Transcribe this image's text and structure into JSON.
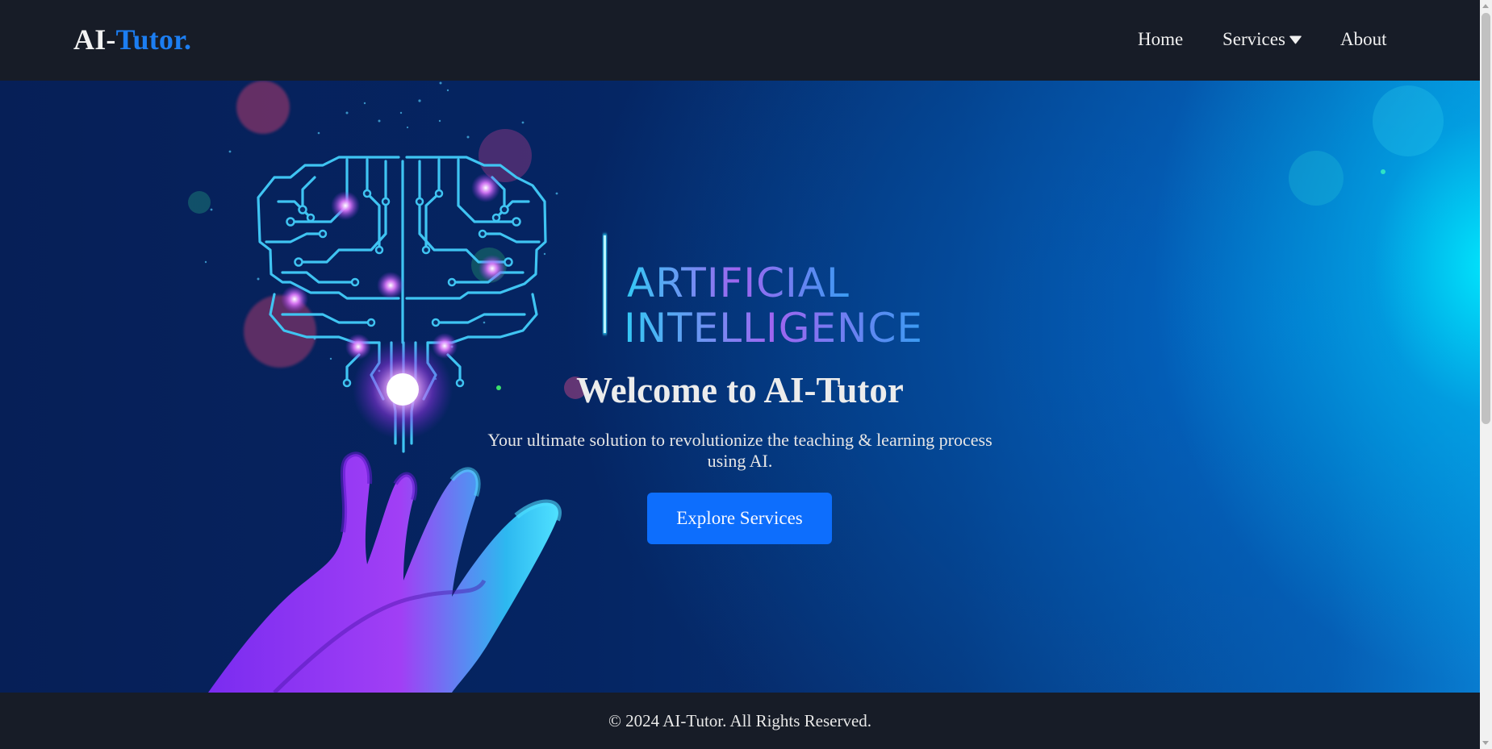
{
  "brand": {
    "prefix": "AI-",
    "accent": "Tutor."
  },
  "nav": {
    "home": "Home",
    "services": "Services",
    "about": "About",
    "services_icon": "caret-down-icon"
  },
  "hero": {
    "artwork_text_line1": "ARTIFICIAL",
    "artwork_text_line2": "INTELLIGENCE",
    "title": "Welcome to AI-Tutor",
    "subtitle": "Your ultimate solution to revolutionize the teaching & learning process using AI.",
    "cta_label": "Explore Services"
  },
  "footer": {
    "text": "© 2024 AI-Tutor. All Rights Reserved."
  },
  "colors": {
    "nav_bg": "#171c27",
    "brand_accent": "#1c7ef2",
    "cta_bg": "#0d6efd",
    "hero_dark": "#052563",
    "hero_glow": "#00ebff"
  }
}
